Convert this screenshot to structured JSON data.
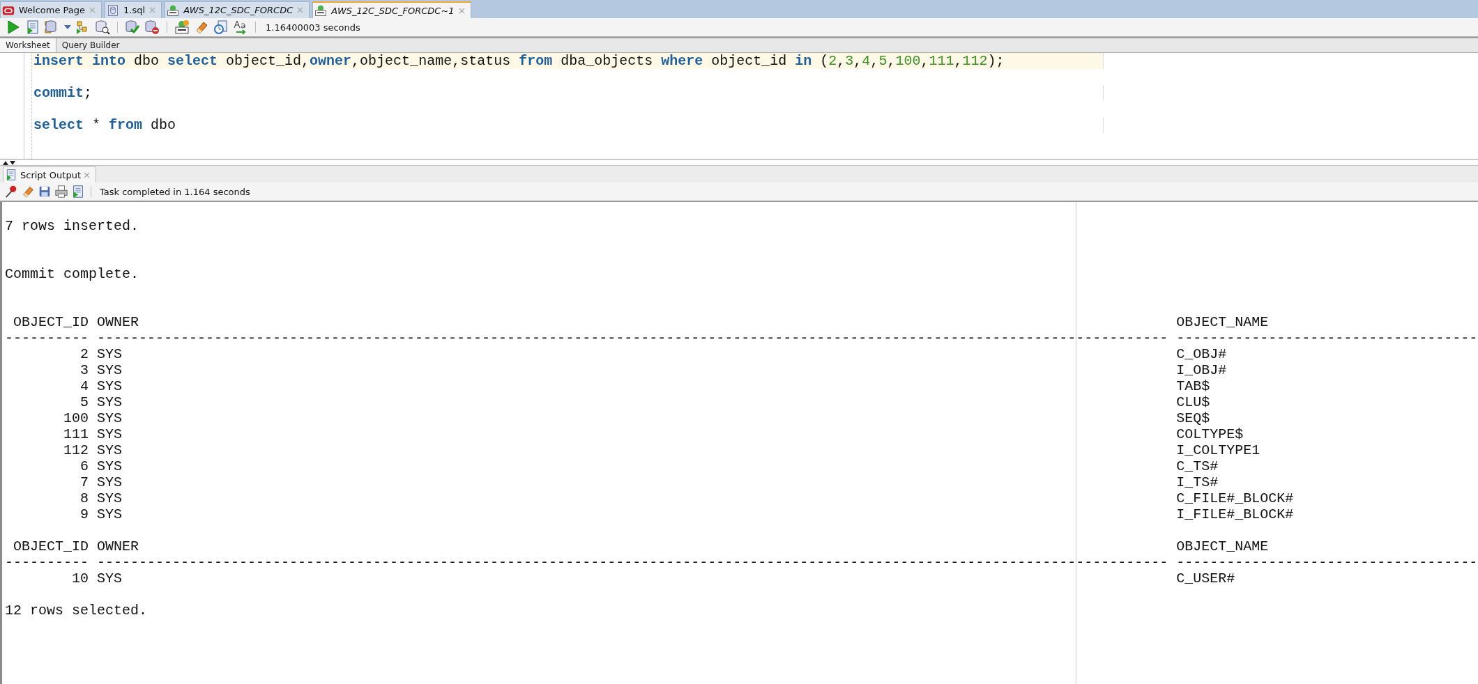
{
  "document_tabs": [
    {
      "label": "Welcome Page",
      "kind": "welcome",
      "italic": false,
      "selected": false
    },
    {
      "label": "1.sql",
      "kind": "file",
      "italic": false,
      "selected": false
    },
    {
      "label": "AWS_12C_SDC_FORCDC",
      "kind": "connection",
      "italic": true,
      "selected": false
    },
    {
      "label": "AWS_12C_SDC_FORCDC~1",
      "kind": "connection",
      "italic": true,
      "selected": true
    }
  ],
  "toolbar": {
    "timing": "1.16400003 seconds"
  },
  "editor_tabs": [
    {
      "label": "Worksheet",
      "selected": true
    },
    {
      "label": "Query Builder",
      "selected": false
    }
  ],
  "editor": {
    "lines": [
      {
        "highlighted": true,
        "tokens": [
          {
            "text": "insert into",
            "kind": "keyword"
          },
          {
            "text": " dbo ",
            "kind": "plain"
          },
          {
            "text": "select",
            "kind": "keyword"
          },
          {
            "text": " object_id,",
            "kind": "plain"
          },
          {
            "text": "owner",
            "kind": "keyword"
          },
          {
            "text": ",object_name,status ",
            "kind": "plain"
          },
          {
            "text": "from",
            "kind": "keyword"
          },
          {
            "text": " dba_objects ",
            "kind": "plain"
          },
          {
            "text": "where",
            "kind": "keyword"
          },
          {
            "text": " object_id ",
            "kind": "plain"
          },
          {
            "text": "in",
            "kind": "keyword"
          },
          {
            "text": " (",
            "kind": "plain"
          },
          {
            "text": "2",
            "kind": "number"
          },
          {
            "text": ",",
            "kind": "plain"
          },
          {
            "text": "3",
            "kind": "number"
          },
          {
            "text": ",",
            "kind": "plain"
          },
          {
            "text": "4",
            "kind": "number"
          },
          {
            "text": ",",
            "kind": "plain"
          },
          {
            "text": "5",
            "kind": "number"
          },
          {
            "text": ",",
            "kind": "plain"
          },
          {
            "text": "100",
            "kind": "number"
          },
          {
            "text": ",",
            "kind": "plain"
          },
          {
            "text": "111",
            "kind": "number"
          },
          {
            "text": ",",
            "kind": "plain"
          },
          {
            "text": "112",
            "kind": "number"
          },
          {
            "text": ");",
            "kind": "plain"
          }
        ]
      },
      {
        "highlighted": false,
        "tokens": [
          {
            "text": "commit",
            "kind": "keyword"
          },
          {
            "text": ";",
            "kind": "plain"
          }
        ]
      },
      {
        "highlighted": false,
        "tokens": [
          {
            "text": "select",
            "kind": "keyword"
          },
          {
            "text": " * ",
            "kind": "plain"
          },
          {
            "text": "from",
            "kind": "keyword"
          },
          {
            "text": " dbo",
            "kind": "plain"
          }
        ]
      }
    ]
  },
  "script_output": {
    "tab": {
      "label": "Script Output",
      "selected": true
    },
    "status": "Task completed in 1.164 seconds",
    "blocks": [
      {
        "kind": "message",
        "text": "7 rows inserted."
      },
      {
        "kind": "message",
        "text": "Commit complete."
      },
      {
        "kind": "table",
        "columns": [
          "OBJECT_ID",
          "OWNER",
          "OBJECT_NAME"
        ],
        "separators": [
          "----------",
          "--------------------------------------------------------------------------------------------------------------------------------",
          "------------------------------------"
        ],
        "rows": [
          [
            "2",
            "SYS",
            "C_OBJ#"
          ],
          [
            "3",
            "SYS",
            "I_OBJ#"
          ],
          [
            "4",
            "SYS",
            "TAB$"
          ],
          [
            "5",
            "SYS",
            "CLU$"
          ],
          [
            "100",
            "SYS",
            "SEQ$"
          ],
          [
            "111",
            "SYS",
            "COLTYPE$"
          ],
          [
            "112",
            "SYS",
            "I_COLTYPE1"
          ],
          [
            "6",
            "SYS",
            "C_TS#"
          ],
          [
            "7",
            "SYS",
            "I_TS#"
          ],
          [
            "8",
            "SYS",
            "C_FILE#_BLOCK#"
          ],
          [
            "9",
            "SYS",
            "I_FILE#_BLOCK#"
          ]
        ]
      },
      {
        "kind": "table",
        "columns": [
          "OBJECT_ID",
          "OWNER",
          "OBJECT_NAME"
        ],
        "separators": [
          "----------",
          "--------------------------------------------------------------------------------------------------------------------------------",
          "------------------------------------"
        ],
        "rows": [
          [
            "10",
            "SYS",
            "C_USER#"
          ]
        ]
      },
      {
        "kind": "message",
        "text": "12 rows selected."
      }
    ]
  }
}
